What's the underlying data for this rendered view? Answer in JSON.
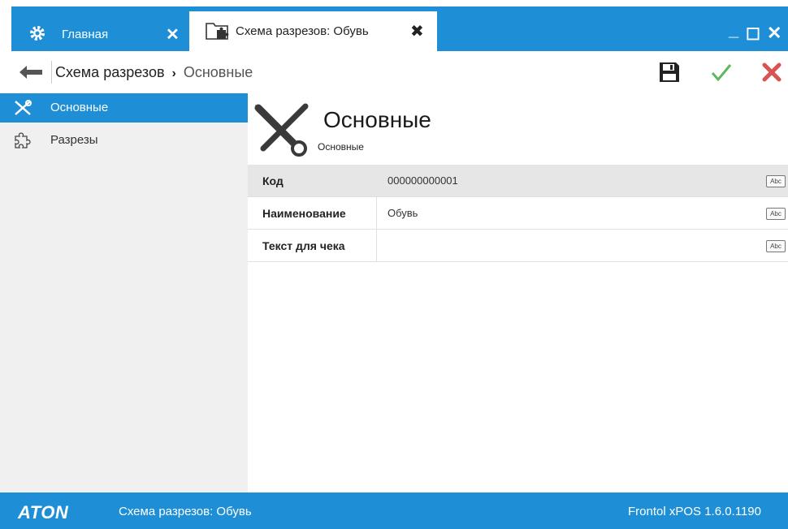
{
  "tabs": {
    "home": {
      "label": "Главная",
      "close": "✕"
    },
    "active": {
      "label": "Схема разрезов: Обувь",
      "close": "✖"
    }
  },
  "window": {
    "minimize": "_",
    "maximize": "☐",
    "close": "✕"
  },
  "toolbar": {
    "breadcrumb_root": "Схема разрезов",
    "breadcrumb_sep": "›",
    "breadcrumb_current": "Основные"
  },
  "sidebar": {
    "items": [
      {
        "label": "Основные",
        "icon": "tools-icon",
        "active": true
      },
      {
        "label": "Разрезы",
        "icon": "puzzle-icon",
        "active": false
      }
    ]
  },
  "main": {
    "title": "Основные",
    "subtitle": "Основные",
    "fields": [
      {
        "label": "Код",
        "value": "000000000001",
        "type": "Abc"
      },
      {
        "label": "Наименование",
        "value": "Обувь",
        "type": "Abc"
      },
      {
        "label": "Текст для чека",
        "value": "",
        "type": "Abc"
      }
    ]
  },
  "status": {
    "logo": "ATON",
    "document": "Схема разрезов: Обувь",
    "version": "Frontol xPOS 1.6.0.1190"
  },
  "colors": {
    "accent": "#1e8fd6",
    "save": "#222222",
    "ok": "#5cb85c",
    "cancel": "#d9534f"
  }
}
